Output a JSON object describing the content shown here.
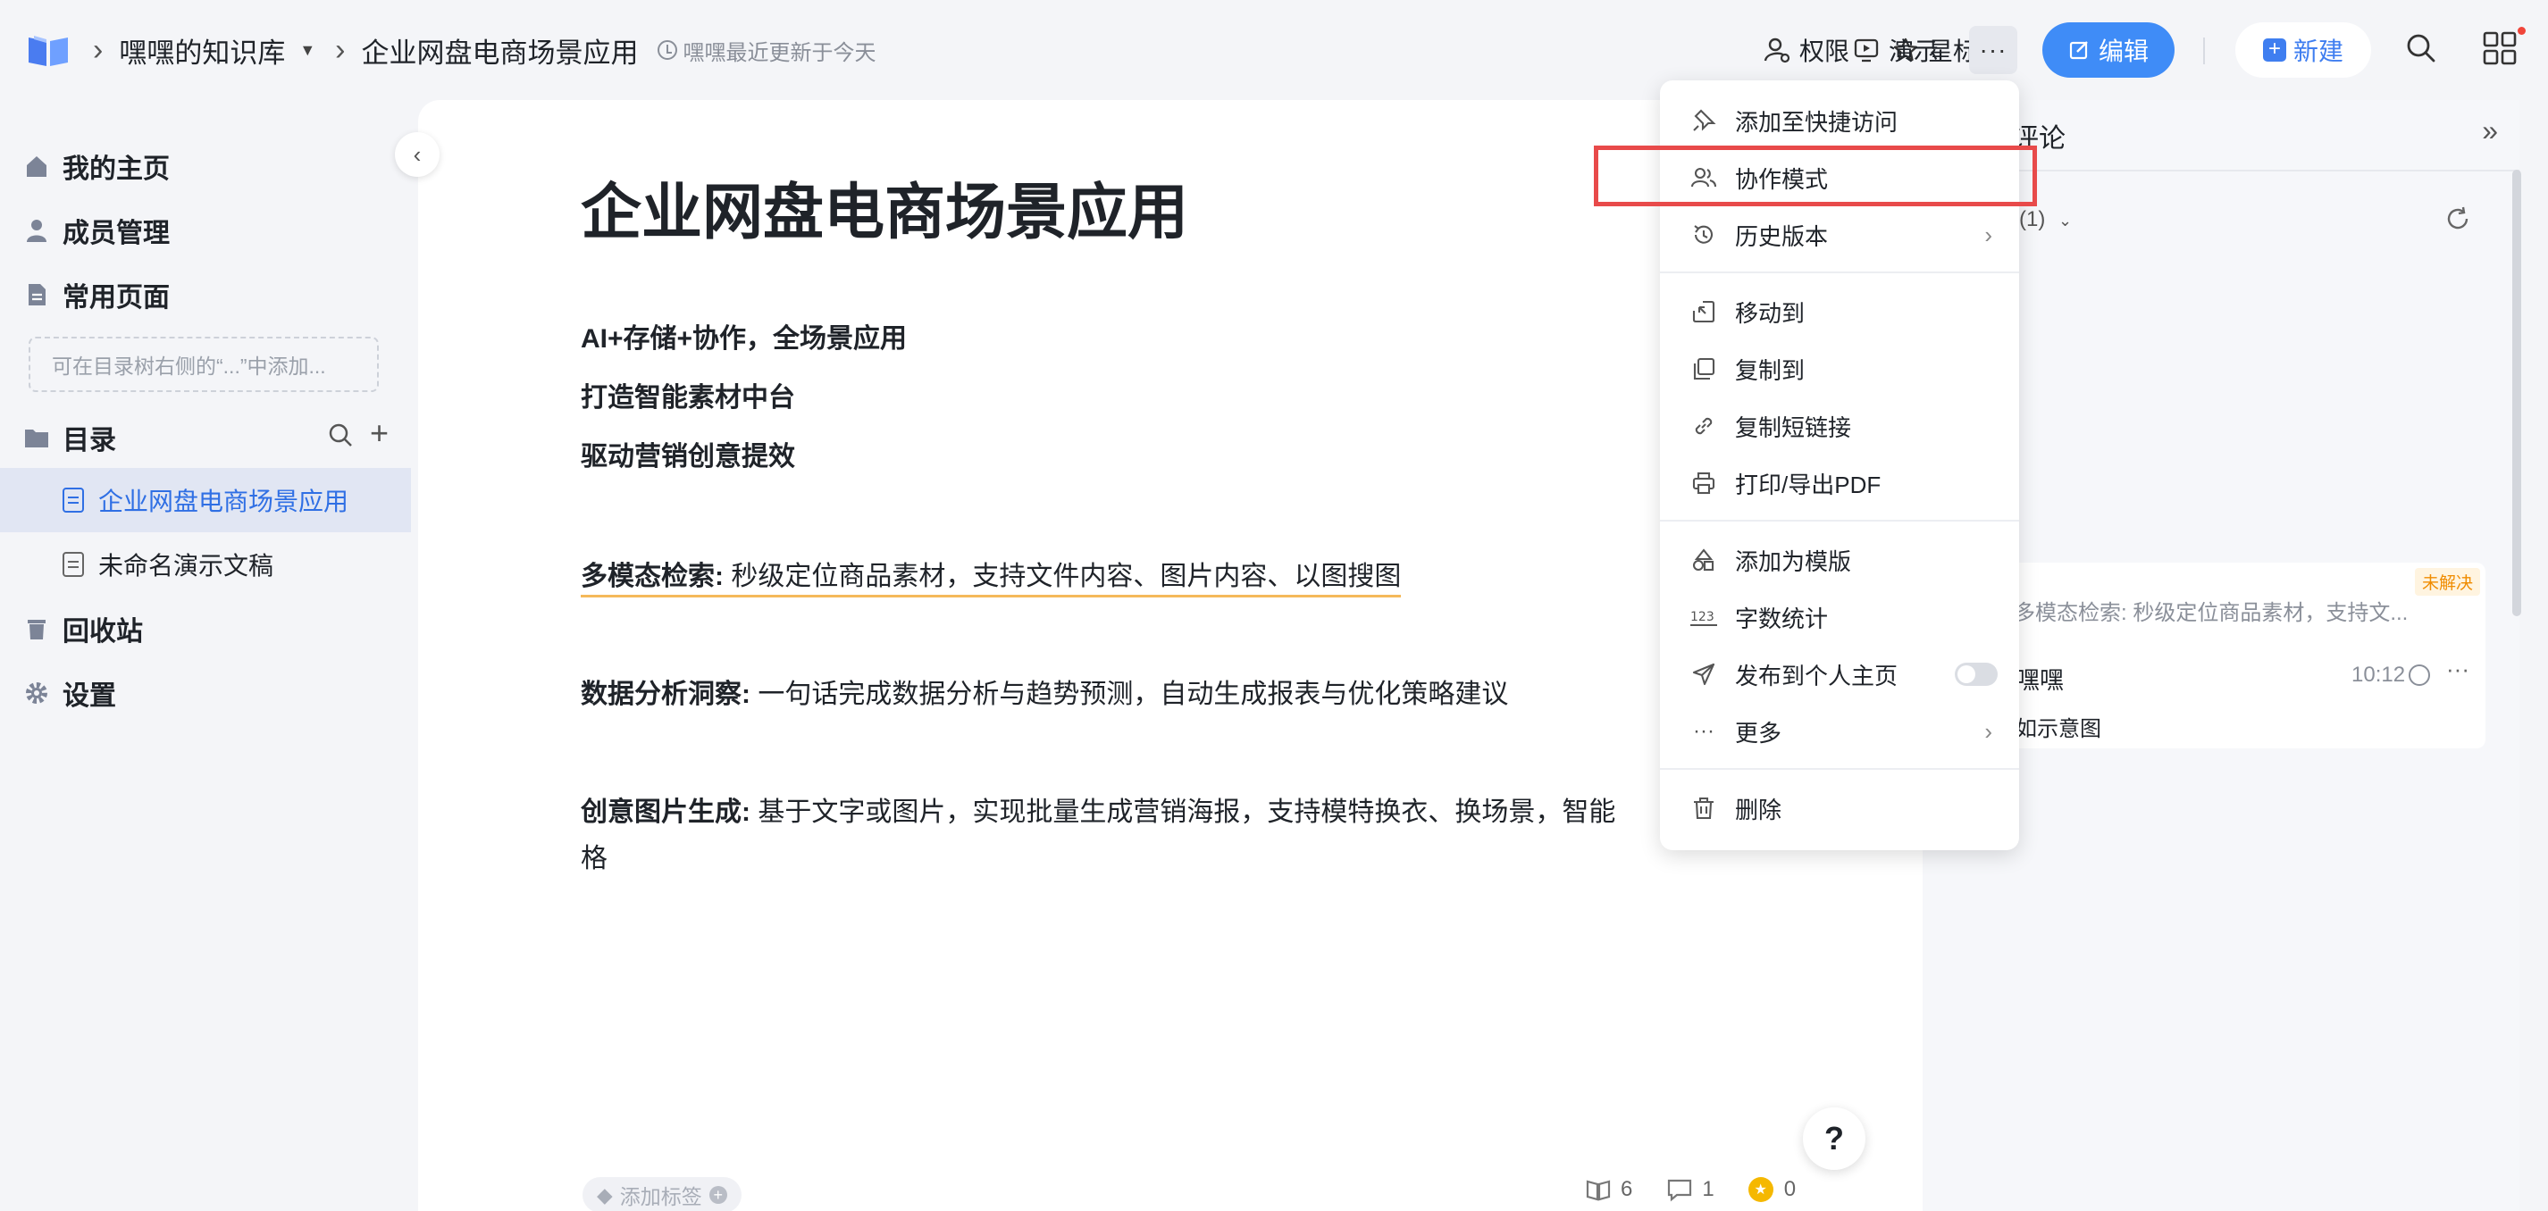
{
  "topbar": {
    "breadcrumb": [
      "嘿嘿的知识库",
      "企业网盘电商场景应用"
    ],
    "updated": "嘿嘿最近更新于今天",
    "actions": {
      "permission": "权限",
      "star": "星标",
      "present": "演示",
      "more": "···",
      "edit": "编辑",
      "new": "新建"
    }
  },
  "sidebar": {
    "home": "我的主页",
    "members": "成员管理",
    "common_pages": "常用页面",
    "hint": "可在目录树右侧的“...”中添加...",
    "catalog": "目录",
    "tree": [
      "企业网盘电商场景应用",
      "未命名演示文稿"
    ],
    "trash": "回收站",
    "settings": "设置"
  },
  "document": {
    "title": "企业网盘电商场景应用",
    "lines": [
      "AI+存储+协作，全场景应用",
      "打造智能素材中台",
      "驱动营销创意提效"
    ],
    "features": [
      {
        "label": "多模态检索:",
        "text": " 秒级定位商品素材，支持文件内容、图片内容、以图搜图"
      },
      {
        "label": "数据分析洞察:",
        "text": " 一句话完成数据分析与趋势预测，自动生成报表与优化策略建议"
      },
      {
        "label": "创意图片生成:",
        "text": " 基于文字或图片，实现批量生成营销海报，支持模特换衣、换场景，智能"
      },
      {
        "label": "",
        "text": "格"
      }
    ],
    "add_tag": "添加标签",
    "stats": {
      "reads": "6",
      "comments": "1",
      "coins": "0"
    },
    "help": "?"
  },
  "comments": {
    "title": "评论",
    "count": "(1)",
    "badge": "未解决",
    "quote": "多模态检索: 秒级定位商品素材，支持文...",
    "user": "嘿嘿",
    "time": "10:12",
    "more": "···",
    "body": "如示意图"
  },
  "menu": {
    "items": [
      "添加至快捷访问",
      "协作模式",
      "历史版本",
      "移动到",
      "复制到",
      "复制短链接",
      "打印/导出PDF",
      "添加为模版",
      "字数统计",
      "发布到个人主页",
      "更多",
      "删除"
    ],
    "highlighted": "协作模式"
  },
  "colors": {
    "accent": "#3f8cf7",
    "active_tree_bg": "#e1e6f3",
    "highlight_box": "#e84a4a",
    "unresolved": "#f08c00"
  }
}
